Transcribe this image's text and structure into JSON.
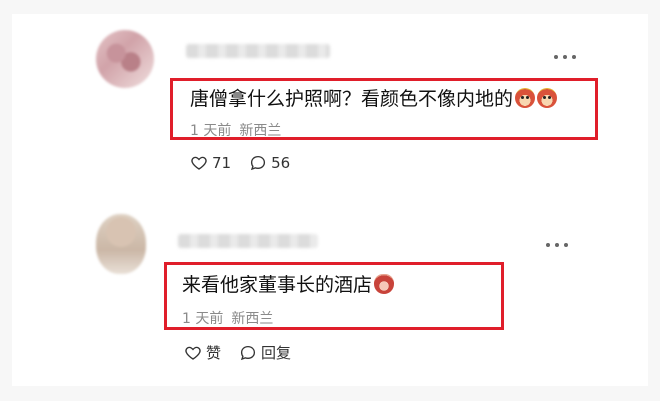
{
  "comments": [
    {
      "text": "唐僧拿什么护照啊？看颜色不像内地的",
      "time": "1 天前",
      "location": "新西兰",
      "likes": "71",
      "replies": "56"
    },
    {
      "text": "来看他家董事长的酒店",
      "time": "1 天前",
      "location": "新西兰",
      "like_label": "赞",
      "reply_label": "回复"
    }
  ],
  "icons": {
    "more": "more-horizontal-icon",
    "like": "heart-icon",
    "reply": "chat-bubble-icon",
    "emoji_1": "monkey-face-emoji",
    "emoji_2": "angry-face-emoji"
  },
  "colors": {
    "highlight_border": "#e01e2a",
    "meta_text": "#8a8a8a"
  }
}
